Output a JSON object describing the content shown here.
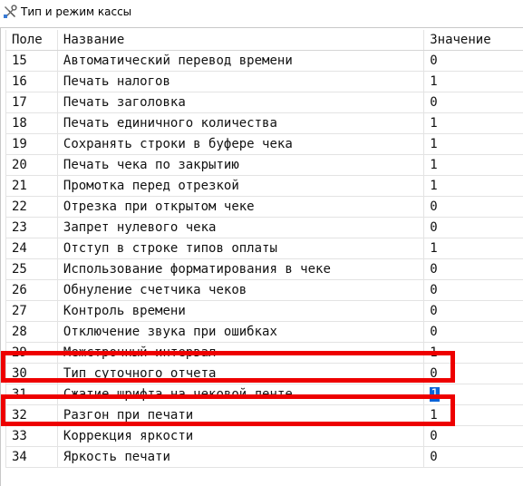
{
  "window": {
    "title": "Тип и режим кассы",
    "icon": "settings-wrench-icon"
  },
  "table": {
    "columns": [
      "Поле",
      "Название",
      "Значение"
    ],
    "rows": [
      {
        "field": "15",
        "name": "Автоматический перевод времени",
        "value": "0"
      },
      {
        "field": "16",
        "name": "Печать налогов",
        "value": "1"
      },
      {
        "field": "17",
        "name": "Печать заголовка",
        "value": "0"
      },
      {
        "field": "18",
        "name": "Печать единичного количества",
        "value": "1"
      },
      {
        "field": "19",
        "name": "Сохранять строки в буфере чека",
        "value": "1"
      },
      {
        "field": "20",
        "name": "Печать чека по закрытию",
        "value": "1"
      },
      {
        "field": "21",
        "name": "Промотка перед отрезкой",
        "value": "1"
      },
      {
        "field": "22",
        "name": "Отрезка при открытом чеке",
        "value": "0"
      },
      {
        "field": "23",
        "name": "Запрет нулевого чека",
        "value": "0"
      },
      {
        "field": "24",
        "name": "Отступ в строке типов оплаты",
        "value": "1"
      },
      {
        "field": "25",
        "name": "Использование форматирования в чеке",
        "value": "0"
      },
      {
        "field": "26",
        "name": "Обнуление счетчика чеков",
        "value": "0"
      },
      {
        "field": "27",
        "name": "Контроль времени",
        "value": "0"
      },
      {
        "field": "28",
        "name": "Отключение звука при ошибках",
        "value": "0"
      },
      {
        "field": "29",
        "name": "Межстрочный интервал",
        "value": "1"
      },
      {
        "field": "30",
        "name": "Тип суточного отчета",
        "value": "0"
      },
      {
        "field": "31",
        "name": "Сжатие шрифта на чековой ленте",
        "value": "1"
      },
      {
        "field": "32",
        "name": "Разгон при печати",
        "value": "1"
      },
      {
        "field": "33",
        "name": "Коррекция яркости",
        "value": "0"
      },
      {
        "field": "34",
        "name": "Яркость печати",
        "value": "0"
      }
    ],
    "selected_field": "31",
    "highlighted_fields": [
      "29",
      "31"
    ]
  },
  "colors": {
    "highlight": "#ee0000",
    "selection": "#0a64d8"
  }
}
